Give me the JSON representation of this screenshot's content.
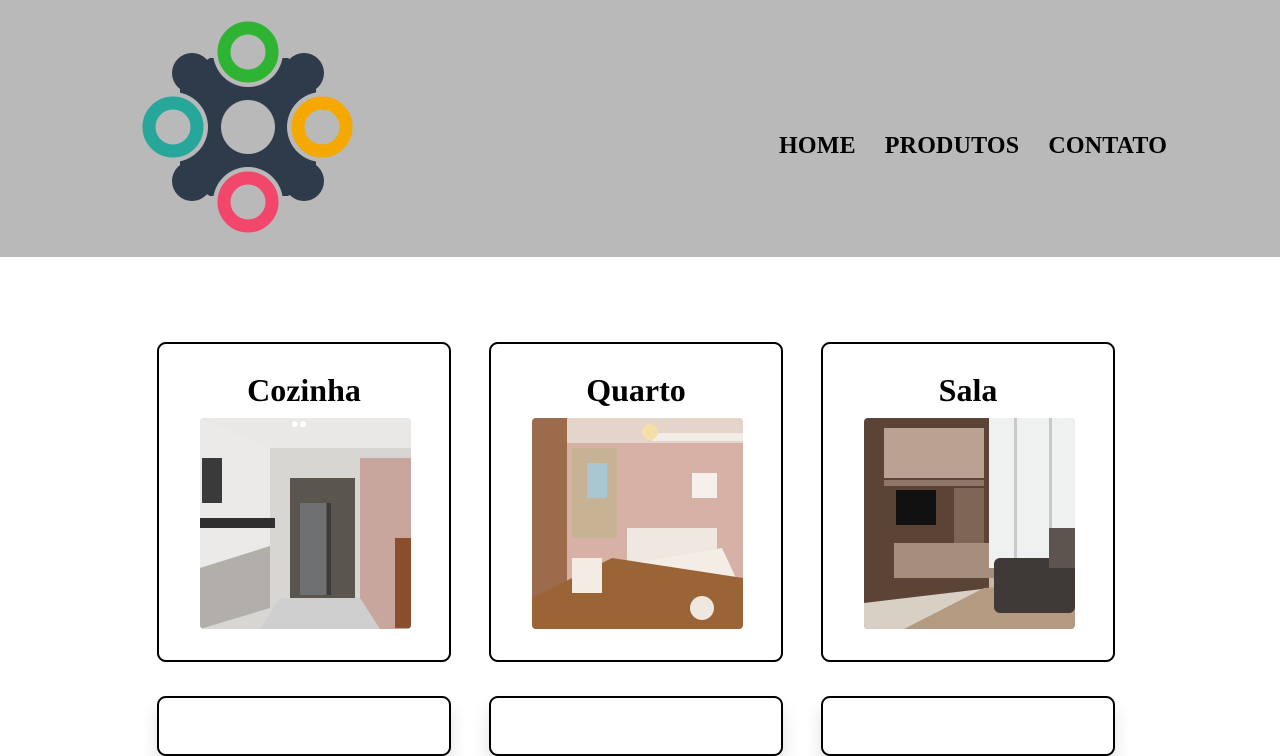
{
  "header": {
    "logo_icon": "molecule-logo",
    "colors": {
      "background": "#b9b9b9",
      "logo_body": "#2d3b4b",
      "green": "#2eb432",
      "teal": "#27a79a",
      "orange": "#f5a800",
      "pink": "#f2466b"
    }
  },
  "nav": {
    "items": [
      {
        "label": "HOME"
      },
      {
        "label": "PRODUTOS"
      },
      {
        "label": "CONTATO"
      }
    ]
  },
  "products": [
    {
      "title": "Cozinha",
      "image": "kitchen-photo"
    },
    {
      "title": "Quarto",
      "image": "bedroom-photo"
    },
    {
      "title": "Sala",
      "image": "living-room-photo"
    }
  ]
}
